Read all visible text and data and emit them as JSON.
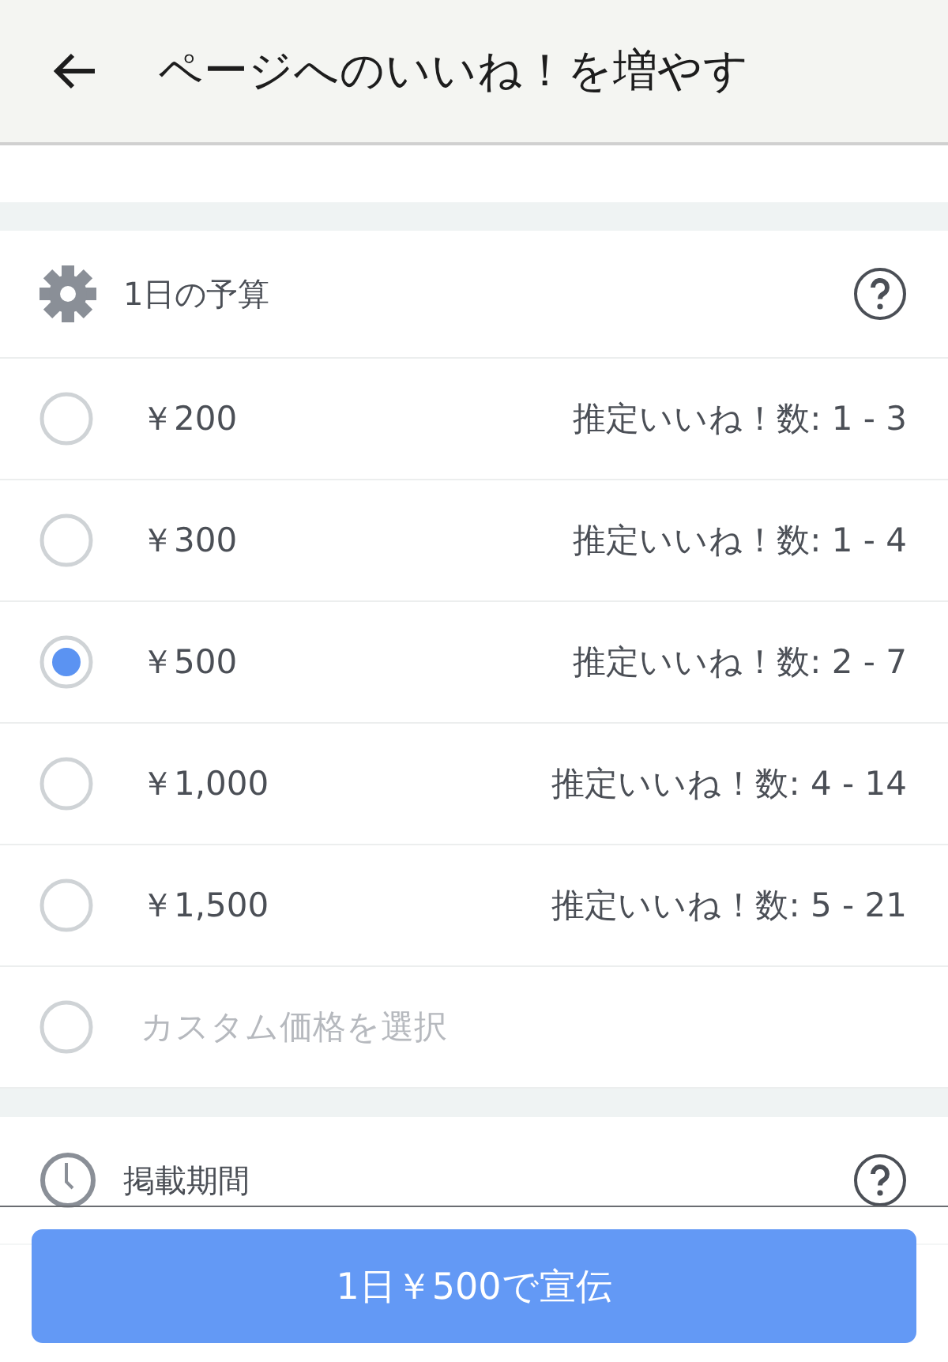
{
  "header": {
    "title": "ページへのいいね！を増やす"
  },
  "budget": {
    "title": "1日の予算",
    "options": [
      {
        "kind": "preset",
        "price": "￥200",
        "estimate": "推定いいね！数: 1 - 3",
        "selected": false
      },
      {
        "kind": "preset",
        "price": "￥300",
        "estimate": "推定いいね！数: 1 - 4",
        "selected": false
      },
      {
        "kind": "preset",
        "price": "￥500",
        "estimate": "推定いいね！数: 2 - 7",
        "selected": true
      },
      {
        "kind": "preset",
        "price": "￥1,000",
        "estimate": "推定いいね！数: 4 - 14",
        "selected": false
      },
      {
        "kind": "preset",
        "price": "￥1,500",
        "estimate": "推定いいね！数: 5 - 21",
        "selected": false
      },
      {
        "kind": "custom",
        "price": "カスタム価格を選択",
        "selected": false
      }
    ]
  },
  "duration": {
    "title": "掲載期間"
  },
  "promote_button": "1日￥500で宣伝"
}
